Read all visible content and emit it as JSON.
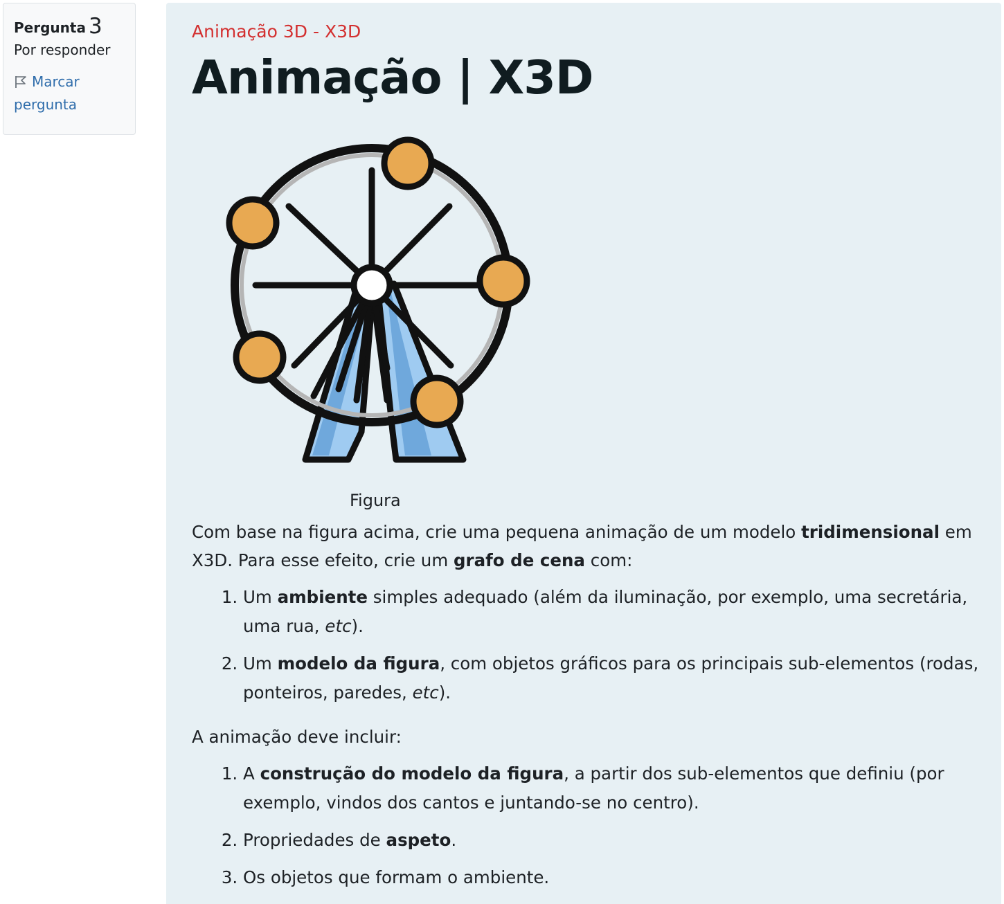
{
  "question_info": {
    "label": "Pergunta",
    "number": "3",
    "state": "Por responder",
    "flag_label": "Marcar pergunta"
  },
  "content": {
    "subtitle": "Animação 3D - X3D",
    "title": "Animação | X3D",
    "figure_caption": "Figura",
    "paragraph1": {
      "t1": "Com base na figura acima, crie uma pequena animação de um modelo ",
      "b1": "tridimensional",
      "t2": " em X3D. Para esse efeito, crie um ",
      "b2": "grafo de cena",
      "t3": " com:"
    },
    "list1": [
      {
        "t1": "Um ",
        "b1": "ambiente",
        "t2": " simples adequado (além da iluminação, por exemplo, uma secretária, uma rua, ",
        "i1": "etc",
        "t3": ")."
      },
      {
        "t1": "Um ",
        "b1": "modelo da figura",
        "t2": ", com objetos gráficos para os principais sub-elementos (rodas, ponteiros, paredes, ",
        "i1": "etc",
        "t3": ")."
      }
    ],
    "paragraph2": "A animação deve incluir:",
    "list2": [
      {
        "t1": "A ",
        "b1": "construção do modelo da figura",
        "t2": ", a partir dos sub-elementos que definiu (por exemplo, vindos dos cantos e juntando-se no centro)."
      },
      {
        "t1": "Propriedades de ",
        "b1": "aspeto",
        "t2": "."
      },
      {
        "t1": "Os objetos que formam o ambiente."
      }
    ]
  },
  "colors": {
    "accent_red": "#d32f2f",
    "link_blue": "#2f6dab",
    "content_bg": "#e7f0f4",
    "cabin_orange": "#e8a952",
    "leg_blue": "#76aee0"
  },
  "icons": {
    "flag": "flag-icon",
    "figure": "ferris-wheel-icon"
  }
}
